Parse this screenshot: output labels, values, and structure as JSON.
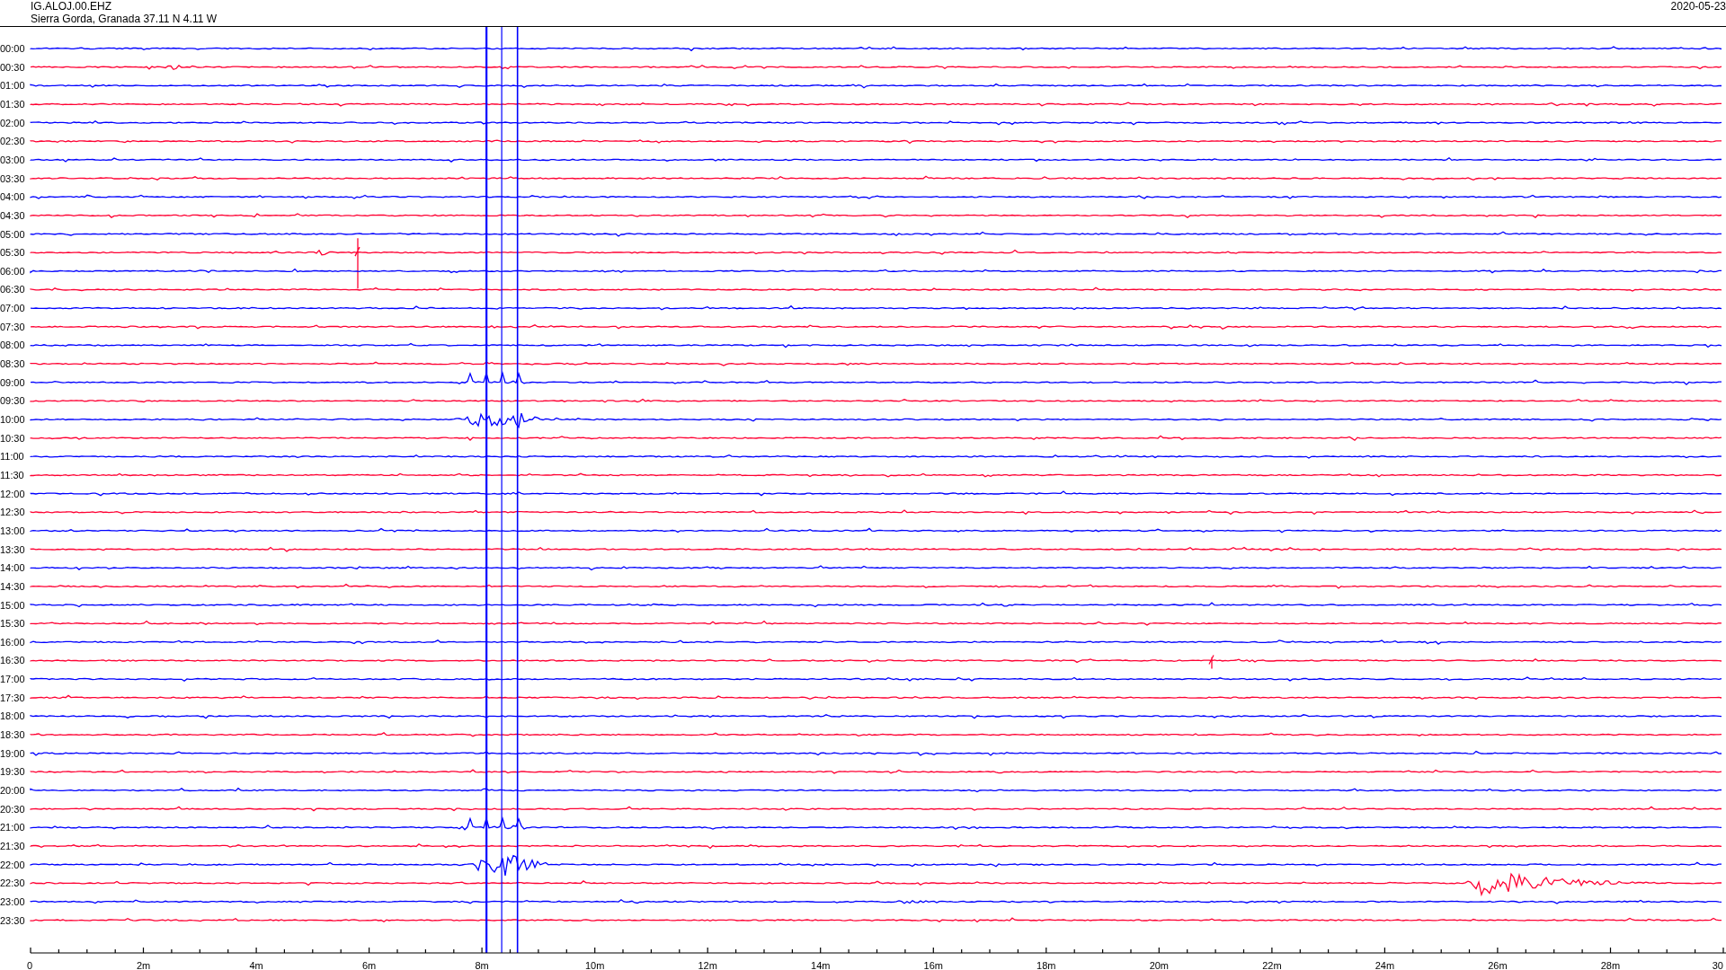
{
  "header": {
    "station": "IG.ALOJ.00.EHZ",
    "location": "Sierra Gorda, Granada  37.11 N 4.11 W",
    "date": "2020-05-23"
  },
  "rows": [
    {
      "time": "00:00",
      "color": "#0000ff"
    },
    {
      "time": "00:30",
      "color": "#ff0033"
    },
    {
      "time": "01:00",
      "color": "#0000ff"
    },
    {
      "time": "01:30",
      "color": "#ff0033"
    },
    {
      "time": "02:00",
      "color": "#0000ff"
    },
    {
      "time": "02:30",
      "color": "#ff0033"
    },
    {
      "time": "03:00",
      "color": "#0000ff"
    },
    {
      "time": "03:30",
      "color": "#ff0033"
    },
    {
      "time": "04:00",
      "color": "#0000ff"
    },
    {
      "time": "04:30",
      "color": "#ff0033"
    },
    {
      "time": "05:00",
      "color": "#0000ff"
    },
    {
      "time": "05:30",
      "color": "#ff0033"
    },
    {
      "time": "06:00",
      "color": "#0000ff"
    },
    {
      "time": "06:30",
      "color": "#ff0033"
    },
    {
      "time": "07:00",
      "color": "#0000ff"
    },
    {
      "time": "07:30",
      "color": "#ff0033"
    },
    {
      "time": "08:00",
      "color": "#0000ff"
    },
    {
      "time": "08:30",
      "color": "#ff0033"
    },
    {
      "time": "09:00",
      "color": "#0000ff"
    },
    {
      "time": "09:30",
      "color": "#ff0033"
    },
    {
      "time": "10:00",
      "color": "#0000ff"
    },
    {
      "time": "10:30",
      "color": "#ff0033"
    },
    {
      "time": "11:00",
      "color": "#0000ff"
    },
    {
      "time": "11:30",
      "color": "#ff0033"
    },
    {
      "time": "12:00",
      "color": "#0000ff"
    },
    {
      "time": "12:30",
      "color": "#ff0033"
    },
    {
      "time": "13:00",
      "color": "#0000ff"
    },
    {
      "time": "13:30",
      "color": "#ff0033"
    },
    {
      "time": "14:00",
      "color": "#0000ff"
    },
    {
      "time": "14:30",
      "color": "#ff0033"
    },
    {
      "time": "15:00",
      "color": "#0000ff"
    },
    {
      "time": "15:30",
      "color": "#ff0033"
    },
    {
      "time": "16:00",
      "color": "#0000ff"
    },
    {
      "time": "16:30",
      "color": "#ff0033"
    },
    {
      "time": "17:00",
      "color": "#0000ff"
    },
    {
      "time": "17:30",
      "color": "#ff0033"
    },
    {
      "time": "18:00",
      "color": "#0000ff"
    },
    {
      "time": "18:30",
      "color": "#ff0033"
    },
    {
      "time": "19:00",
      "color": "#0000ff"
    },
    {
      "time": "19:30",
      "color": "#ff0033"
    },
    {
      "time": "20:00",
      "color": "#0000ff"
    },
    {
      "time": "20:30",
      "color": "#ff0033"
    },
    {
      "time": "21:00",
      "color": "#0000ff"
    },
    {
      "time": "21:30",
      "color": "#ff0033"
    },
    {
      "time": "22:00",
      "color": "#0000ff"
    },
    {
      "time": "22:30",
      "color": "#ff0033"
    },
    {
      "time": "23:00",
      "color": "#0000ff"
    },
    {
      "time": "23:30",
      "color": "#ff0033"
    }
  ],
  "axis_labels": [
    "0",
    "2m",
    "4m",
    "6m",
    "8m",
    "10m",
    "12m",
    "14m",
    "16m",
    "18m",
    "20m",
    "22m",
    "24m",
    "26m",
    "28m",
    "30"
  ]
}
